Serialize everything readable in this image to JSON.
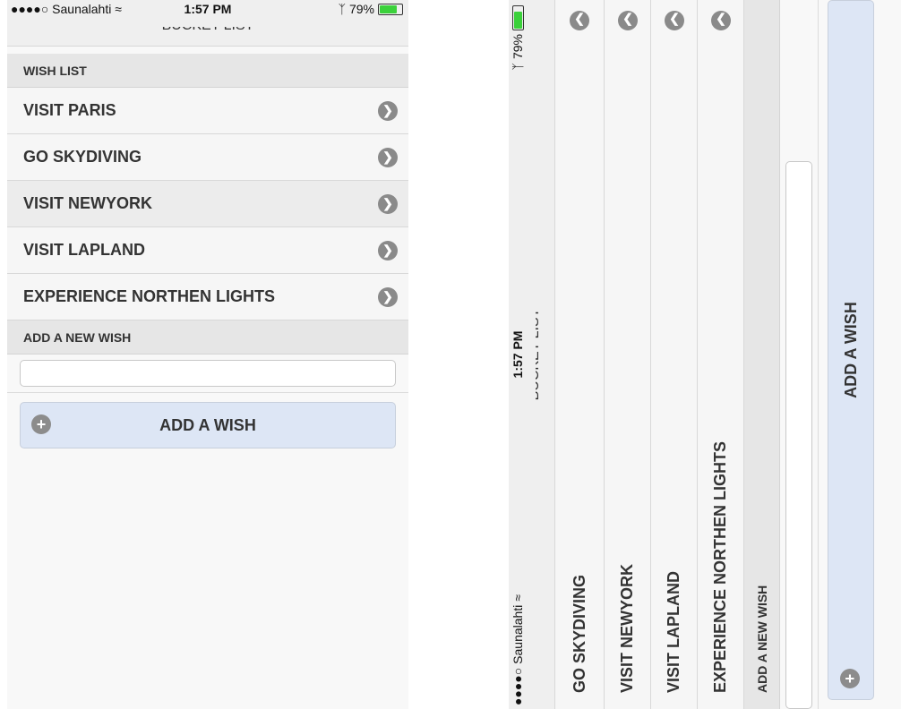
{
  "status": {
    "carrier": "●●●●○ Saunalahti",
    "wifi_icon": "wifi-icon",
    "time": "1:57 PM",
    "bluetooth_icon": "bluetooth-icon",
    "battery_percent": "79%",
    "battery_level": 0.79,
    "battery_color": "#3bd13b"
  },
  "header": {
    "title": "BUCKET LIST"
  },
  "wish_list": {
    "heading": "WISH LIST",
    "items": [
      {
        "label": "VISIT PARIS"
      },
      {
        "label": "GO SKYDIVING"
      },
      {
        "label": "VISIT NEWYORK"
      },
      {
        "label": "VISIT LAPLAND"
      },
      {
        "label": "EXPERIENCE NORTHEN LIGHTS"
      }
    ]
  },
  "new_wish": {
    "heading": "ADD A NEW WISH",
    "input_value": "",
    "button_label": "ADD A WISH"
  },
  "colors": {
    "button_bg": "#dde6f5",
    "divider_bg": "#e6e6e6",
    "row_bg": "#f6f6f6"
  }
}
